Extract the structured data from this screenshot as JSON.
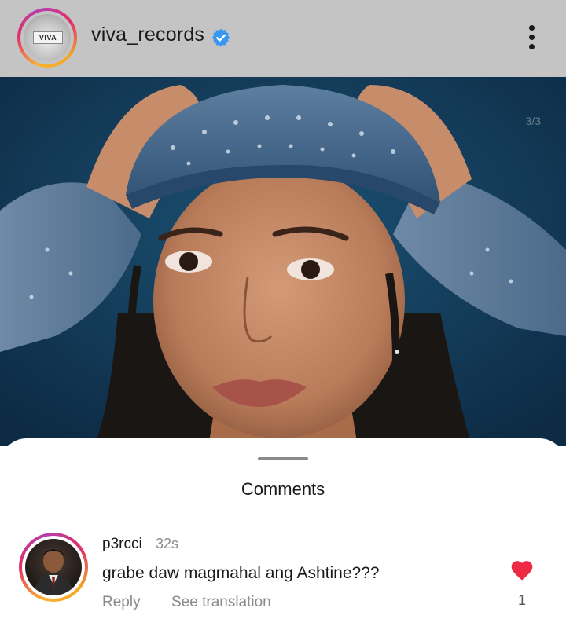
{
  "header": {
    "username": "viva_records",
    "avatar_logo": "VIVA",
    "verified_color": "#3897f0",
    "more_icon": "more-vertical-icon"
  },
  "post": {
    "slide_counter": "3/3"
  },
  "comments_sheet": {
    "title": "Comments",
    "comment": {
      "author": "p3rcci",
      "time": "32s",
      "text": "grabe daw magmahal ang Ashtine???",
      "reply_label": "Reply",
      "translate_label": "See translation",
      "like_count": "1",
      "heart_color": "#ed2944"
    }
  }
}
